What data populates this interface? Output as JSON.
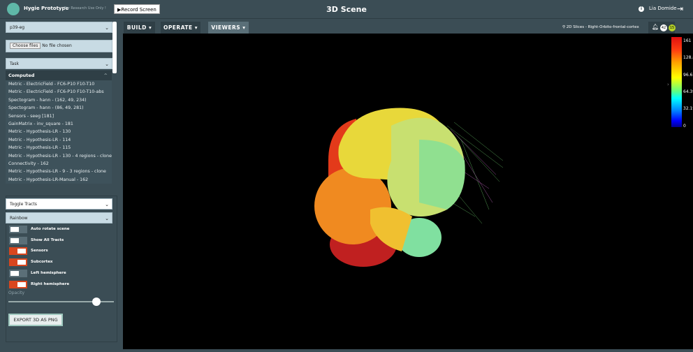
{
  "header": {
    "app_name": "Hygie Prototype",
    "subtitle": "For Research Use Only !",
    "record_label": "Record Screen",
    "title": "3D Scene",
    "user": "Lia Domide"
  },
  "sidebar": {
    "project_select": "p39-eg",
    "file_button": "Choose files",
    "file_status": "No file chosen",
    "task_select": "Task",
    "computed_title": "Computed",
    "computed_items": [
      "Metric - ElectricField - FC6-P10 F10-T10",
      "Metric - ElectricField - FC6-P10 F10-T10-abs",
      "Spectogram - hann - (162, 49, 234)",
      "Spectogram - hann - (86, 49, 281)",
      "Sensors - seeg [181]",
      "GainMatrix - inv_square - 181",
      "Metric - Hypothesis-LR - 130",
      "Metric - Hypothesis-LR - 114",
      "Metric - Hypothesis-LR - 115",
      "Metric - Hypothesis-LR - 130 - 4 regions - clone",
      "Connectivity - 162",
      "Metric - Hypothesis-LR - 9 - 3 regions - clone",
      "Metric - Hypothesis-LR-Manual - 162"
    ],
    "tracts_select": "Toggle Tracts",
    "colormap_select": "Rainbow",
    "toggles": [
      {
        "label": "Auto rotate scene",
        "on": false
      },
      {
        "label": "Show All Tracts",
        "on": false
      },
      {
        "label": "Sensors",
        "on": true
      },
      {
        "label": "Subcortex",
        "on": true
      },
      {
        "label": "Left hemisphere",
        "on": false
      },
      {
        "label": "Right hemisphere",
        "on": true
      }
    ],
    "opacity_label": "Opacity",
    "opacity_value": 0.85,
    "export_label": "EXPORT 3D AS PNG"
  },
  "tabs": [
    "BUILD ▾",
    "OPERATE ▾",
    "VIEWERS ▾"
  ],
  "location": "2D Slices - Right-Orbito-frontal-cortex",
  "notifications": {
    "count_a": "42",
    "count_b": "15"
  },
  "colorbar": {
    "ticks": [
      "161",
      "128.8",
      "96.6",
      "64.39",
      "32.19",
      "0"
    ]
  }
}
